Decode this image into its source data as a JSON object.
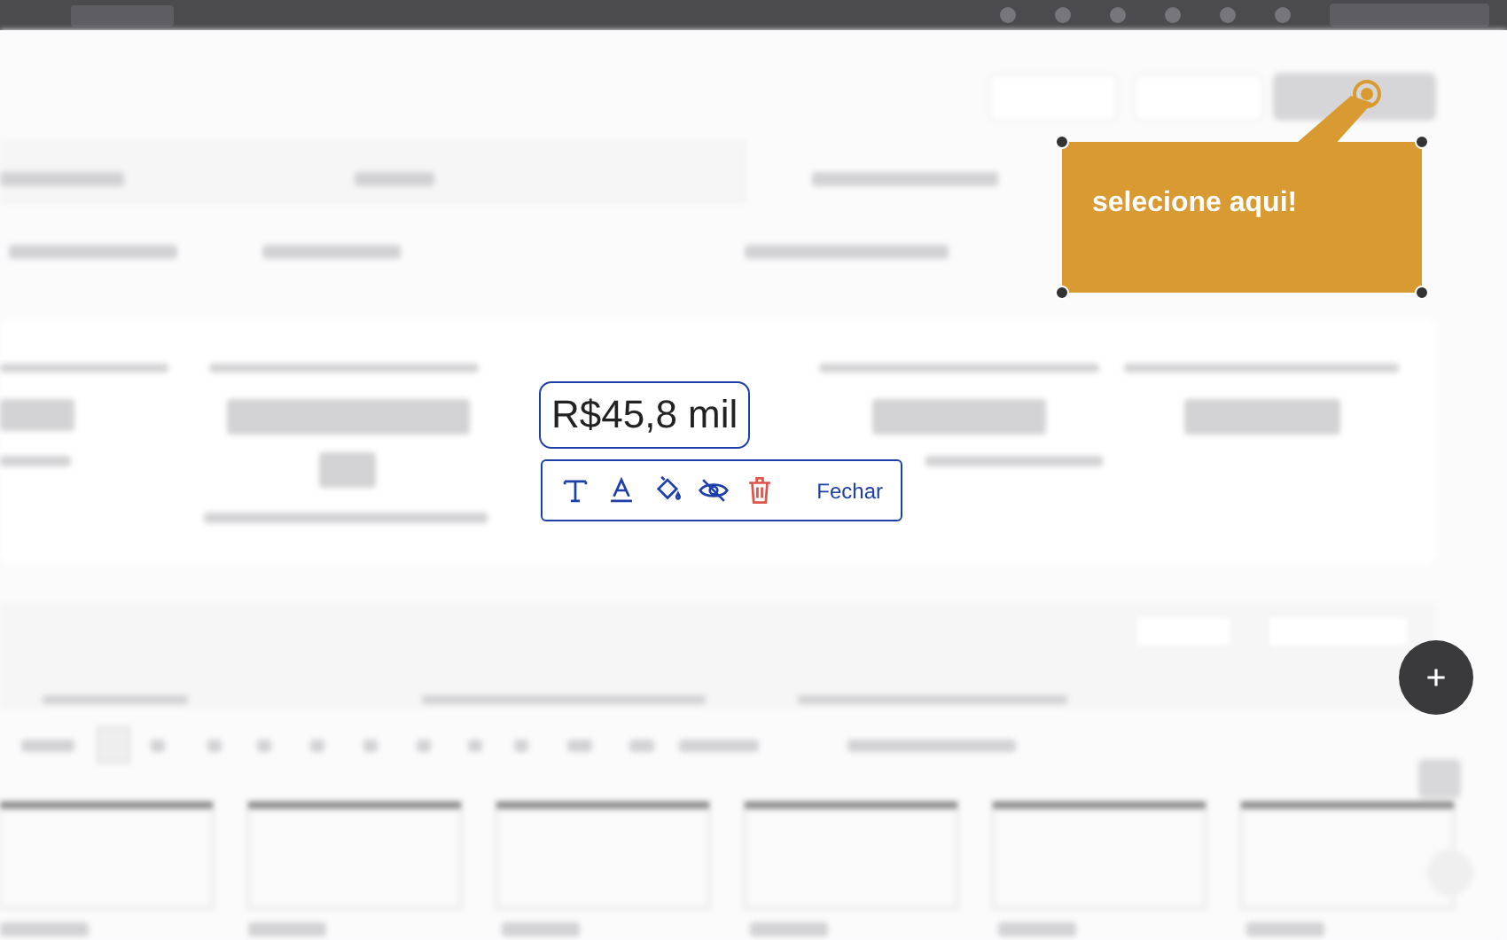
{
  "selected_metric": {
    "value": "R$45,8 mil"
  },
  "editor_toolbar": {
    "close": "Fechar"
  },
  "callout": {
    "text": "selecione aqui!"
  }
}
